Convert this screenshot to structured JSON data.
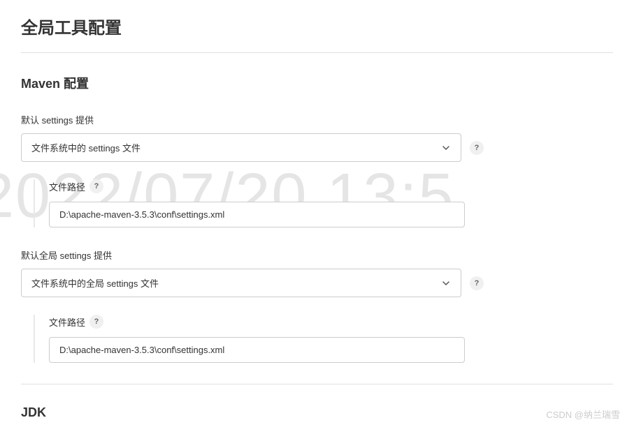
{
  "page": {
    "title": "全局工具配置"
  },
  "maven": {
    "section_title": "Maven 配置",
    "default_settings": {
      "label": "默认 settings 提供",
      "select_value": "文件系统中的 settings 文件",
      "file_path": {
        "label": "文件路径",
        "value": "D:\\apache-maven-3.5.3\\conf\\settings.xml"
      }
    },
    "default_global_settings": {
      "label": "默认全局 settings 提供",
      "select_value": "文件系统中的全局 settings 文件",
      "file_path": {
        "label": "文件路径",
        "value": "D:\\apache-maven-3.5.3\\conf\\settings.xml"
      }
    }
  },
  "jdk": {
    "section_title": "JDK"
  },
  "watermark": {
    "date": "2022/07/20 13:5",
    "author": "CSDN @纳兰瑞雪"
  },
  "icons": {
    "help": "?"
  }
}
